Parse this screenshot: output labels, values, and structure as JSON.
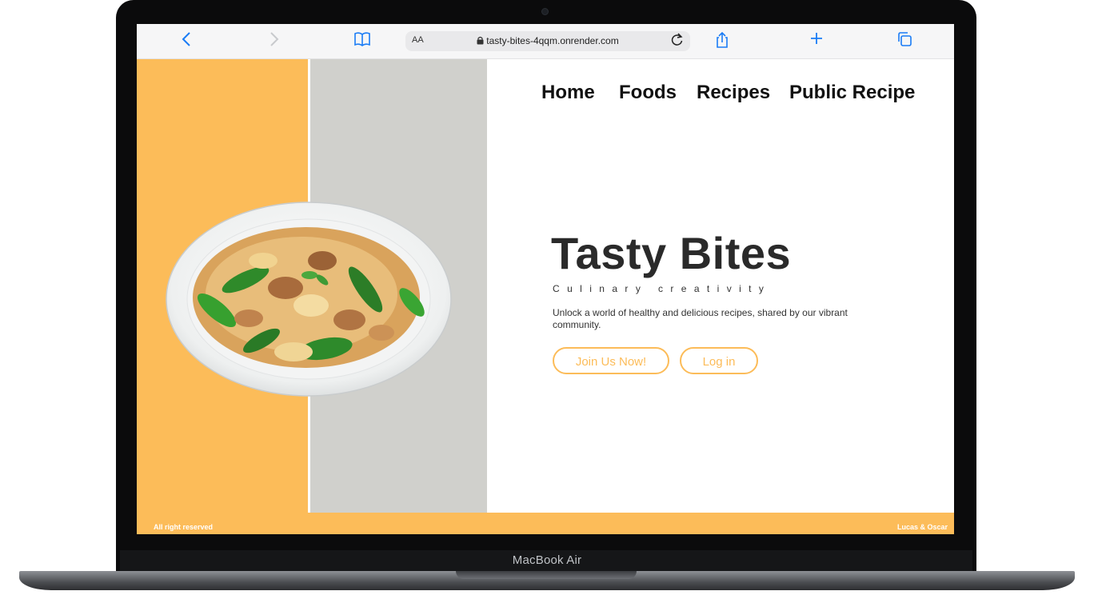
{
  "device": {
    "label": "MacBook Air"
  },
  "browser": {
    "reader_label": "AA",
    "url": "tasty-bites-4qqm.onrender.com",
    "icons": {
      "back": "chevron-left-icon",
      "forward": "chevron-right-icon",
      "bookmarks": "book-icon",
      "reload": "reload-icon",
      "share": "share-icon",
      "new_tab": "plus-icon",
      "tabs": "tabs-icon"
    }
  },
  "nav": {
    "items": [
      {
        "label": "Home"
      },
      {
        "label": "Foods"
      },
      {
        "label": "Recipes"
      },
      {
        "label": "Public Recipe"
      }
    ]
  },
  "hero": {
    "title": "Tasty Bites",
    "subtitle": "Culinary creativity",
    "description": "Unlock a world of healthy and delicious recipes, shared by our vibrant community.",
    "primary_cta": "Join Us Now!",
    "secondary_cta": "Log in"
  },
  "footer": {
    "left": "All right reserved",
    "right": "Lucas & Oscar"
  },
  "colors": {
    "accent": "#fcbc59",
    "panel_gray": "#d0d0cc",
    "browser_blue": "#1a7cf5"
  }
}
